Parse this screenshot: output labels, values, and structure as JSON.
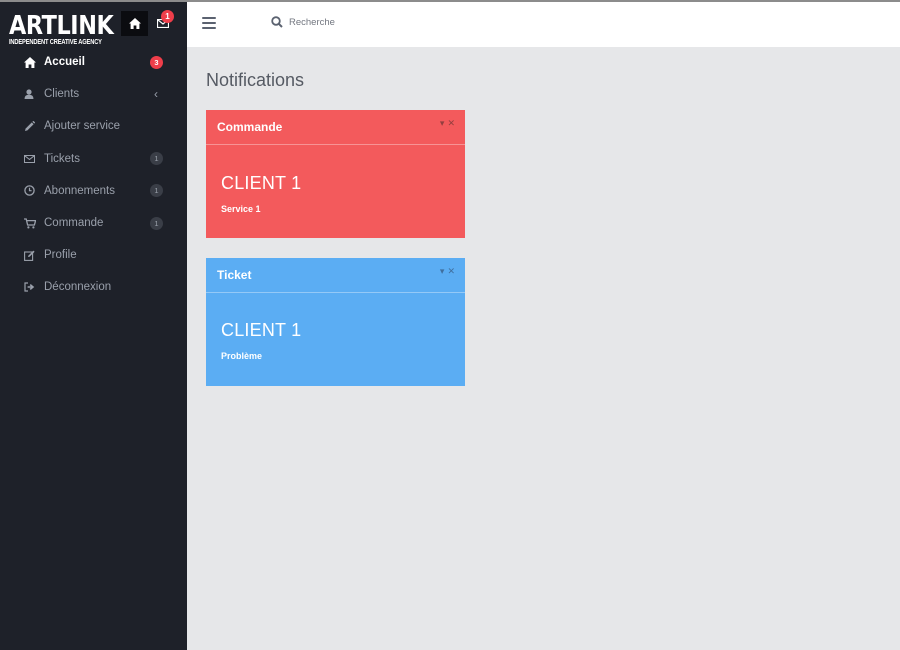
{
  "brand": {
    "title": "ARTLINK",
    "subtitle": "INDEPENDENT CREATIVE AGENCY",
    "mail_count": "1"
  },
  "sidebar": {
    "items": [
      {
        "label": "Accueil",
        "icon": "home-icon",
        "badge": "3",
        "active": true
      },
      {
        "label": "Clients",
        "icon": "user-icon",
        "chevron": "‹"
      },
      {
        "label": "Ajouter service",
        "icon": "pencil-icon"
      },
      {
        "label": "Tickets",
        "icon": "envelope-icon",
        "badge": "1"
      },
      {
        "label": "Abonnements",
        "icon": "clock-icon",
        "badge": "1"
      },
      {
        "label": "Commande",
        "icon": "cart-icon",
        "badge": "1"
      },
      {
        "label": "Profile",
        "icon": "edit-icon"
      },
      {
        "label": "Déconnexion",
        "icon": "sign-out-icon"
      }
    ]
  },
  "header": {
    "search_placeholder": "Recherche"
  },
  "main": {
    "title": "Notifications",
    "cards": [
      {
        "title": "Commande",
        "client": "CLIENT 1",
        "detail": "Service 1",
        "color": "#f35a5c"
      },
      {
        "title": "Ticket",
        "client": "CLIENT 1",
        "detail": "Problème",
        "color": "#5badf3"
      }
    ]
  },
  "colors": {
    "sidebar_bg": "#1e2129",
    "content_bg": "#e6e7e9",
    "badge_red": "#ef3e4a"
  }
}
